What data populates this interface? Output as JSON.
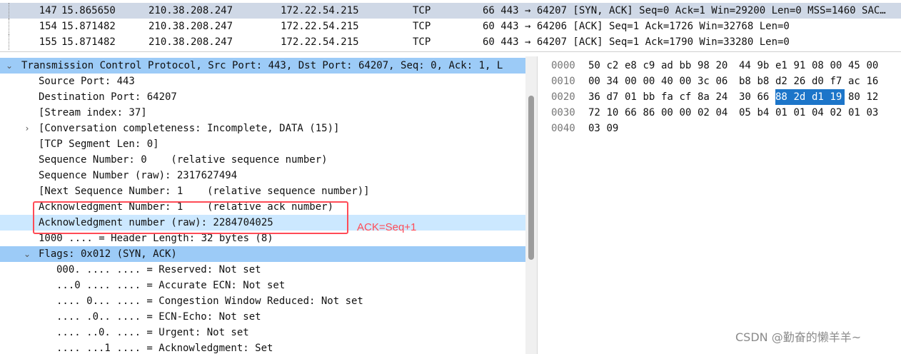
{
  "packet_list": {
    "rows": [
      {
        "no": "147",
        "time": "15.865650",
        "src": "210.38.208.247",
        "dst": "172.22.54.215",
        "proto": "TCP",
        "info": "66 443 → 64207 [SYN, ACK] Seq=0 Ack=1 Win=29200 Len=0 MSS=1460 SAC…",
        "selected": true
      },
      {
        "no": "154",
        "time": "15.871482",
        "src": "210.38.208.247",
        "dst": "172.22.54.215",
        "proto": "TCP",
        "info": "60 443 → 64206 [ACK] Seq=1 Ack=1726 Win=32768 Len=0",
        "selected": false
      },
      {
        "no": "155",
        "time": "15.871482",
        "src": "210.38.208.247",
        "dst": "172.22.54.215",
        "proto": "TCP",
        "info": "60 443 → 64207 [ACK] Seq=1 Ack=1790 Win=33280 Len=0",
        "selected": false
      }
    ]
  },
  "details": {
    "rows": [
      {
        "text": "Transmission Control Protocol, Src Port: 443, Dst Port: 64207, Seq: 0, Ack: 1, L",
        "arrow": "⌄",
        "style": "hl2"
      },
      {
        "text": "Source Port: 443"
      },
      {
        "text": "Destination Port: 64207"
      },
      {
        "text": "[Stream index: 37]"
      },
      {
        "text": "[Conversation completeness: Incomplete, DATA (15)]",
        "arrow": "›"
      },
      {
        "text": "[TCP Segment Len: 0]"
      },
      {
        "text": "Sequence Number: 0    (relative sequence number)"
      },
      {
        "text": "Sequence Number (raw): 2317627494"
      },
      {
        "text": "[Next Sequence Number: 1    (relative sequence number)]"
      },
      {
        "text": "Acknowledgment Number: 1    (relative ack number)"
      },
      {
        "text": "Acknowledgment number (raw): 2284704025",
        "style": "hl"
      },
      {
        "text": "1000 .... = Header Length: 32 bytes (8)"
      },
      {
        "text": "Flags: 0x012 (SYN, ACK)",
        "arrow": "⌄",
        "style": "hl2"
      },
      {
        "text": "000. .... .... = Reserved: Not set",
        "indent": 2
      },
      {
        "text": "...0 .... .... = Accurate ECN: Not set",
        "indent": 2
      },
      {
        "text": ".... 0... .... = Congestion Window Reduced: Not set",
        "indent": 2
      },
      {
        "text": ".... .0.. .... = ECN-Echo: Not set",
        "indent": 2
      },
      {
        "text": ".... ..0. .... = Urgent: Not set",
        "indent": 2
      },
      {
        "text": ".... ...1 .... = Acknowledgment: Set",
        "indent": 2
      }
    ]
  },
  "annotation": {
    "text": "ACK=Seq+1",
    "color": "#ff4b56"
  },
  "hex": {
    "rows": [
      {
        "offset": "0000",
        "bytes": [
          "50",
          "c2",
          "e8",
          "c9",
          "ad",
          "bb",
          "98",
          "20",
          "44",
          "9b",
          "e1",
          "91",
          "08",
          "00",
          "45",
          "00"
        ]
      },
      {
        "offset": "0010",
        "bytes": [
          "00",
          "34",
          "00",
          "00",
          "40",
          "00",
          "3c",
          "06",
          "b8",
          "b8",
          "d2",
          "26",
          "d0",
          "f7",
          "ac",
          "16"
        ]
      },
      {
        "offset": "0020",
        "bytes": [
          "36",
          "d7",
          "01",
          "bb",
          "fa",
          "cf",
          "8a",
          "24",
          "30",
          "66",
          "88",
          "2d",
          "d1",
          "19",
          "80",
          "12"
        ],
        "selected_range": [
          10,
          13
        ]
      },
      {
        "offset": "0030",
        "bytes": [
          "72",
          "10",
          "66",
          "86",
          "00",
          "00",
          "02",
          "04",
          "05",
          "b4",
          "01",
          "01",
          "04",
          "02",
          "01",
          "03"
        ]
      },
      {
        "offset": "0040",
        "bytes": [
          "03",
          "09"
        ]
      }
    ]
  },
  "watermark": "CSDN @勤奋的懒羊羊~"
}
